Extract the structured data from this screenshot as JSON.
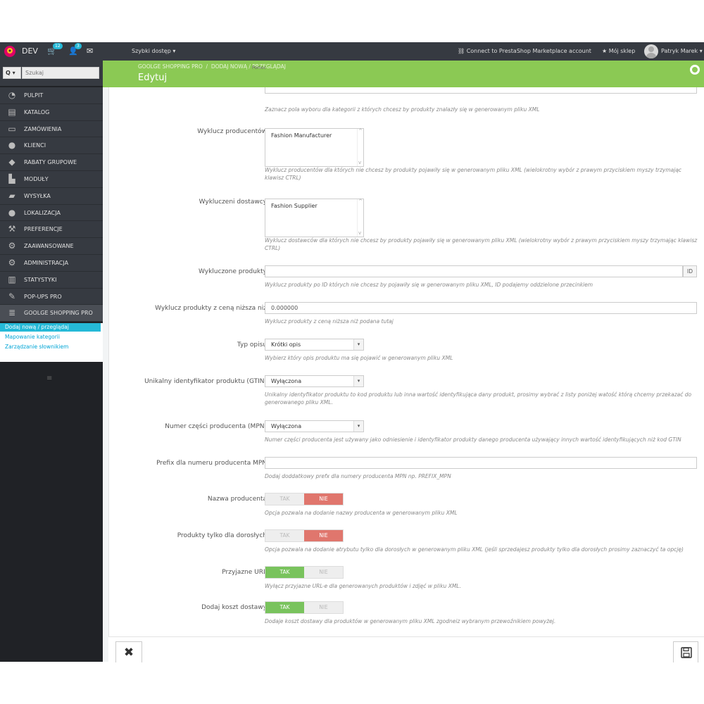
{
  "topbar": {
    "shop_name": "DEV",
    "cart_badge": "12",
    "customers_badge": "3",
    "quick_access": "Szybki dostęp",
    "marketplace": "Connect to PrestaShop Marketplace account",
    "my_shop": "Mój sklep",
    "user": "Patryk Marek"
  },
  "sidebar": {
    "search_button": "Q",
    "search_placeholder": "Szukaj",
    "items": [
      {
        "label": "PULPIT",
        "icon": "dashboard-icon"
      },
      {
        "label": "KATALOG",
        "icon": "book-icon"
      },
      {
        "label": "ZAMÓWIENIA",
        "icon": "credit-card-icon"
      },
      {
        "label": "KLIENCI",
        "icon": "users-icon"
      },
      {
        "label": "RABATY GRUPOWE",
        "icon": "tags-icon"
      },
      {
        "label": "MODUŁY",
        "icon": "puzzle-icon"
      },
      {
        "label": "WYSYŁKA",
        "icon": "truck-icon"
      },
      {
        "label": "LOKALIZACJA",
        "icon": "globe-icon"
      },
      {
        "label": "PREFERENCJE",
        "icon": "wrench-icon"
      },
      {
        "label": "ZAAWANSOWANE",
        "icon": "cogs-icon"
      },
      {
        "label": "ADMINISTRACJA",
        "icon": "cog-icon"
      },
      {
        "label": "STATYSTYKI",
        "icon": "bar-chart-icon"
      },
      {
        "label": "POP-UPS PRO",
        "icon": "edit-icon"
      },
      {
        "label": "GOOLGE SHOPPING PRO",
        "icon": "database-icon"
      }
    ],
    "submenu": [
      {
        "label": "Dodaj nową / przeglądaj"
      },
      {
        "label": "Mapowanie kategorii"
      },
      {
        "label": "Zarządzanie słownikiem"
      }
    ]
  },
  "header": {
    "breadcrumb_1": "GOOLGE SHOPPING PRO",
    "breadcrumb_sep": "/",
    "breadcrumb_2": "DODAJ NOWĄ / PRZEGLĄDAJ",
    "title": "Edytuj",
    "help": "Pomoc"
  },
  "form": {
    "categories_help": "Zaznacz pola wyboru dla kategorii z których chcesz by produkty znalazły się w generowanym pliku XML",
    "exclude_manufacturers": {
      "label": "Wyklucz producentów",
      "option": "Fashion Manufacturer",
      "help": "Wyklucz producentów dla których nie chcesz by produkty pojawiły się w generowanym pliku XML (wielokrotny wybór z prawym przyciskiem myszy trzymając klawisz CTRL)"
    },
    "exclude_suppliers": {
      "label": "Wykluczeni dostawcy",
      "option": "Fashion Supplier",
      "help": "Wyklucz dostawców dla których nie chcesz by produkty pojawiły się w generowanym pliku XML (wielokrotny wybór z prawym przyciskiem myszy trzymając klawisz CTRL)"
    },
    "excluded_products": {
      "label": "Wykluczone produkty",
      "value": "",
      "addon": "ID",
      "help": "Wyklucz produkty po ID których nie chcesz by pojawiły się w generowanym pliku XML, ID podajemy oddzielone przecinkiem"
    },
    "min_price": {
      "label": "Wyklucz produkty z ceną niższa niż",
      "value": "0.000000",
      "help": "Wyklucz produkty z ceną niższa niż podana tutaj"
    },
    "description_type": {
      "label": "Typ opisu",
      "value": "Krótki opis",
      "help": "Wybierz który opis produktu ma się pojawić w generowanym pliku XML"
    },
    "gtin": {
      "label": "Unikalny identyfikator produktu (GTIN)",
      "value": "Wyłączona",
      "help": "Unikalny identyfikator produktu to kod produktu lub inna wartość identyfikująca dany produkt, prosimy wybrać z listy poniżej watość którą chcemy przekazać do generowanego pliku XML."
    },
    "mpn": {
      "label": "Numer części producenta (MPN)",
      "value": "Wyłączona",
      "help": "Numer części producenta jest używany jako odniesienie i identyfikator produkty danego producenta używający innych wartość identyfikujących niż kod GTIN"
    },
    "mpn_prefix": {
      "label": "Prefix dla numeru producenta MPN",
      "value": "",
      "help": "Dodaj doddatkowy prefx dla numery producenta MPN np. PREFIX_MPN"
    },
    "manufacturer_name": {
      "label": "Nazwa producenta",
      "yes": "TAK",
      "no": "NIE",
      "help": "Opcja pozwala na dodanie nazwy producenta w generowanym pliku XML"
    },
    "adult_only": {
      "label": "Produkty tylko dla dorosłych",
      "yes": "TAK",
      "no": "NIE",
      "help": "Opcja pozwala na dodanie atrybutu tylko dla dorosłych w generowanym pliku XML (jeśli sprzedajesz produkty tylko dla dorosłych prosimy zaznaczyć ta opcję)"
    },
    "friendly_url": {
      "label": "Przyjazne URL",
      "yes": "TAK",
      "no": "NIE",
      "help": "Wyłącz przyjazne URL-e dla generowanych produktów i zdjęć w pliku XML."
    },
    "shipping_cost": {
      "label": "Dodaj koszt dostawy",
      "yes": "TAK",
      "no": "NIE",
      "help": "Dodaje koszt dostawy dla produktów w generowanym pliku XML zgodneiz wybranym przewoźnikiem powyżej."
    }
  },
  "colors": {
    "header": "#8bc954",
    "toggle_on": "#79c35d",
    "toggle_off": "#e0766d",
    "sidebar_active": "#25b9d7"
  }
}
